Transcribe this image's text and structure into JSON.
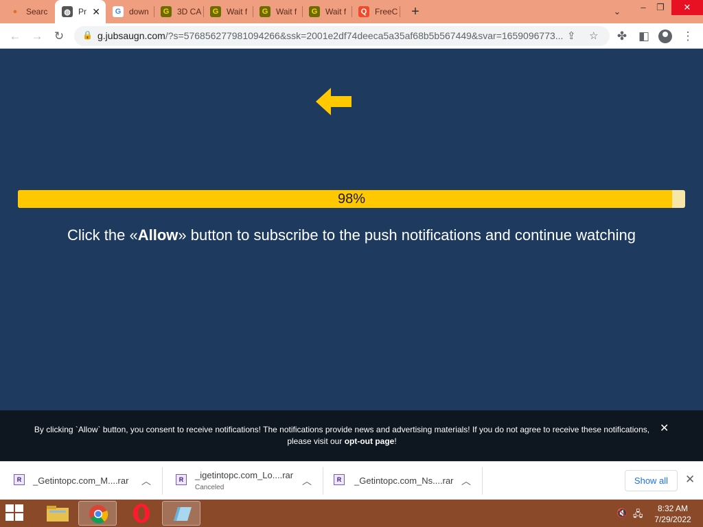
{
  "browser": {
    "tabs": [
      {
        "title": "Searc",
        "icon": "location-dot-icon",
        "active": false
      },
      {
        "title": "Pr",
        "icon": "globe-icon",
        "active": true
      },
      {
        "title": "down",
        "icon": "google-icon",
        "active": false
      },
      {
        "title": "3D CA",
        "icon": "g-site-icon",
        "active": false
      },
      {
        "title": "Wait f",
        "icon": "g-site-icon",
        "active": false
      },
      {
        "title": "Wait f",
        "icon": "g-site-icon",
        "active": false
      },
      {
        "title": "Wait f",
        "icon": "g-site-icon",
        "active": false
      },
      {
        "title": "FreeC",
        "icon": "freecad-icon",
        "active": false
      }
    ],
    "url_host": "g.jubsaugn.com",
    "url_rest": "/?s=576856277981094266&ssk=2001e2df74deeca5a35af68b5b567449&svar=1659096773..."
  },
  "page": {
    "progress_percent": 98,
    "progress_label": "98%",
    "headline_prefix": "Click the «",
    "headline_bold": "Allow",
    "headline_suffix": "» button to subscribe to the push notifications and continue watching",
    "arrow_color": "#ffc800",
    "background_color": "#1e3a5f"
  },
  "consent": {
    "text": "By clicking `Allow` button, you consent to receive notifications! The notifications provide news and advertising materials! If you do not agree to receive these notifications,",
    "line2_prefix": "please visit our ",
    "link": "opt-out page",
    "line2_suffix": "!"
  },
  "downloads": {
    "items": [
      {
        "name": "_Getintopc.com_M....rar",
        "status": ""
      },
      {
        "name": "_igetintopc.com_Lo....rar",
        "status": "Canceled"
      },
      {
        "name": "_Getintopc.com_Ns....rar",
        "status": ""
      }
    ],
    "show_all": "Show all"
  },
  "taskbar": {
    "time": "8:32 AM",
    "date": "7/29/2022"
  }
}
